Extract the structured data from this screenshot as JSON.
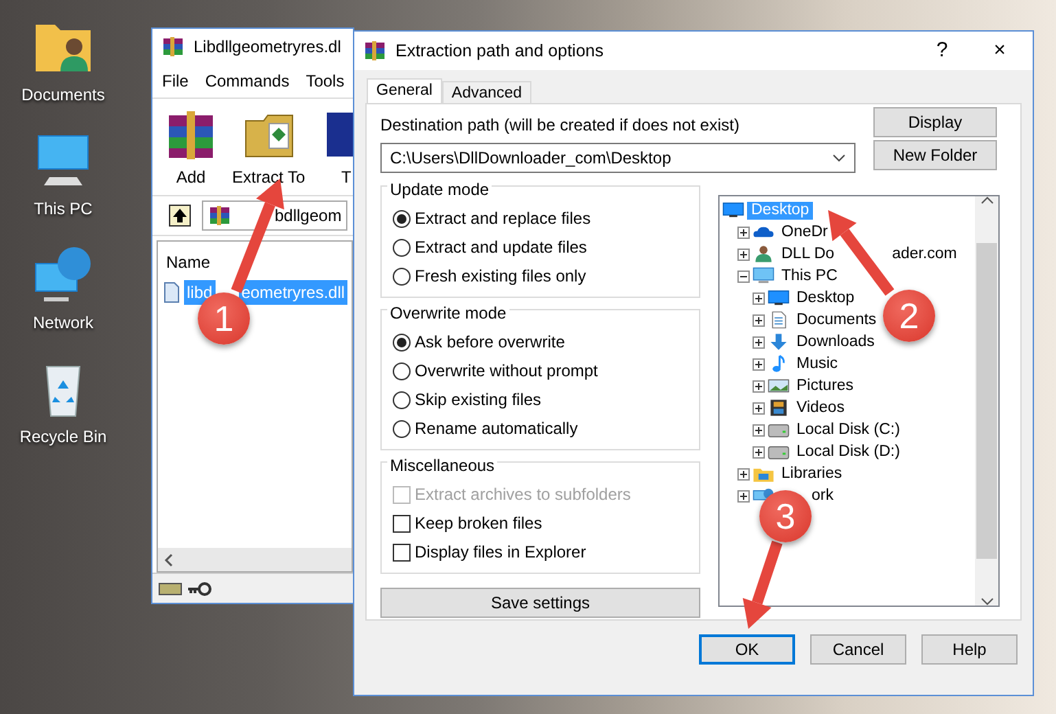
{
  "desktop_icons": [
    {
      "label": "Documents",
      "kind": "docs"
    },
    {
      "label": "This PC",
      "kind": "pc"
    },
    {
      "label": "Network",
      "kind": "network"
    },
    {
      "label": "Recycle Bin",
      "kind": "bin"
    }
  ],
  "archive_window": {
    "title": "Libdllgeometryres.dl",
    "menu": [
      "File",
      "Commands",
      "Tools"
    ],
    "toolbar": [
      {
        "label": "Add",
        "kind": "add"
      },
      {
        "label": "Extract To",
        "kind": "extract"
      },
      {
        "label": "T",
        "kind": "test"
      }
    ],
    "address": "bdllgeom",
    "columns": [
      "Name"
    ],
    "files": [
      {
        "name_start": "libd",
        "name_end": "eometryres.dll",
        "selected": true
      }
    ]
  },
  "dialog": {
    "title": "Extraction path and options",
    "help": "?",
    "close": "×",
    "tabs": [
      {
        "label": "General",
        "selected": true
      },
      {
        "label": "Advanced",
        "selected": false
      }
    ],
    "destination_label": "Destination path (will be created if does not exist)",
    "destination_value": "C:\\Users\\DllDownloader_com\\Desktop",
    "side_buttons": [
      "Display",
      "New Folder"
    ],
    "groups": [
      {
        "title": "Update mode",
        "options": [
          {
            "kind": "radio",
            "label": "Extract and replace files",
            "checked": true,
            "disabled": false
          },
          {
            "kind": "radio",
            "label": "Extract and update files",
            "checked": false,
            "disabled": false
          },
          {
            "kind": "radio",
            "label": "Fresh existing files only",
            "checked": false,
            "disabled": false
          }
        ]
      },
      {
        "title": "Overwrite mode",
        "options": [
          {
            "kind": "radio",
            "label": "Ask before overwrite",
            "checked": true,
            "disabled": false
          },
          {
            "kind": "radio",
            "label": "Overwrite without prompt",
            "checked": false,
            "disabled": false
          },
          {
            "kind": "radio",
            "label": "Skip existing files",
            "checked": false,
            "disabled": false
          },
          {
            "kind": "radio",
            "label": "Rename automatically",
            "checked": false,
            "disabled": false
          }
        ]
      },
      {
        "title": "Miscellaneous",
        "options": [
          {
            "kind": "checkbox",
            "label": "Extract archives to subfolders",
            "checked": false,
            "disabled": true
          },
          {
            "kind": "checkbox",
            "label": "Keep broken files",
            "checked": false,
            "disabled": false
          },
          {
            "kind": "checkbox",
            "label": "Display files in Explorer",
            "checked": false,
            "disabled": false
          }
        ]
      }
    ],
    "save_button": "Save settings",
    "tree": [
      {
        "label": "Desktop",
        "kind": "screen",
        "selected": true,
        "children": [
          {
            "label": "OneDr",
            "kind": "cloud",
            "selected": false,
            "expanded": false
          },
          {
            "label": "DLL Do",
            "label_tail": "ader.com",
            "kind": "user",
            "selected": false,
            "expanded": false
          },
          {
            "label": "This PC",
            "kind": "pc",
            "selected": false,
            "expanded": true,
            "children": [
              {
                "label": "Desktop",
                "kind": "screen",
                "selected": false,
                "expanded": false
              },
              {
                "label": "Documents",
                "kind": "doc",
                "selected": false,
                "expanded": false
              },
              {
                "label": "Downloads",
                "kind": "download",
                "selected": false,
                "expanded": false
              },
              {
                "label": "Music",
                "kind": "music",
                "selected": false,
                "expanded": false
              },
              {
                "label": "Pictures",
                "kind": "picture",
                "selected": false,
                "expanded": false
              },
              {
                "label": "Videos",
                "kind": "video",
                "selected": false,
                "expanded": false
              },
              {
                "label": "Local Disk (C:)",
                "kind": "disk",
                "selected": false,
                "expanded": false
              },
              {
                "label": "Local Disk (D:)",
                "kind": "disk",
                "selected": false,
                "expanded": false
              }
            ]
          },
          {
            "label": "Libraries",
            "kind": "library",
            "selected": false,
            "expanded": false
          },
          {
            "label": "ork",
            "kind": "network",
            "selected": false,
            "expanded": false
          }
        ]
      }
    ],
    "buttons": [
      {
        "label": "OK",
        "default": true
      },
      {
        "label": "Cancel",
        "default": false
      },
      {
        "label": "Help",
        "default": false
      }
    ]
  },
  "annotations": [
    {
      "number": "1"
    },
    {
      "number": "2"
    },
    {
      "number": "3"
    }
  ]
}
